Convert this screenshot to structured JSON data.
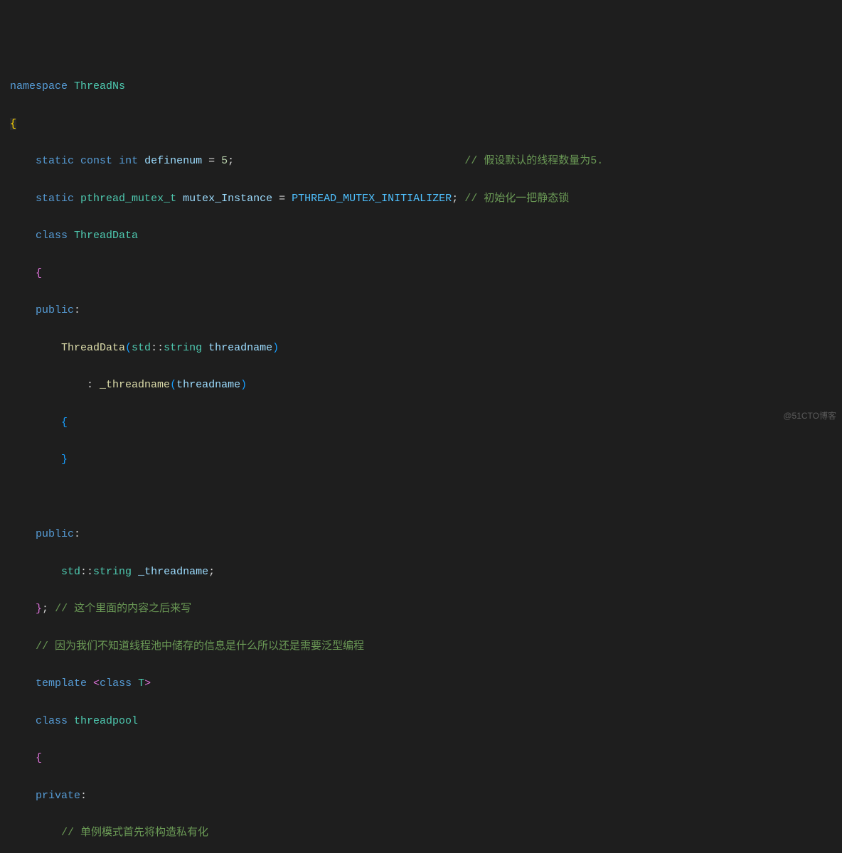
{
  "code": {
    "l1_kw": "namespace",
    "l1_name": "ThreadNs",
    "l2_brace": "{",
    "l4_static": "static",
    "l4_const": "const",
    "l4_int": "int",
    "l4_var": "definenum",
    "l4_eq": " = ",
    "l4_val": "5",
    "l4_semi": ";",
    "l4_cmt": "// 假设默认的线程数量为5.",
    "l5_static": "static",
    "l5_type": "pthread_mutex_t",
    "l5_var": "mutex_Instance",
    "l5_eq": " = ",
    "l5_val": "PTHREAD_MUTEX_INITIALIZER",
    "l5_semi": ";",
    "l5_cmt": "// 初始化一把静态锁",
    "l6_class": "class",
    "l6_name": "ThreadData",
    "l7_brace": "{",
    "l8_public": "public",
    "l8_colon": ":",
    "l9_ctor": "ThreadData",
    "l9_p1": "(",
    "l9_ns": "std",
    "l9_cc": "::",
    "l9_str": "string",
    "l9_arg": "threadname",
    "l9_p2": ")",
    "l10_colon": ": ",
    "l10_member": "_threadname",
    "l10_p1": "(",
    "l10_arg": "threadname",
    "l10_p2": ")",
    "l11_brace": "{",
    "l12_brace": "}",
    "l14_public": "public",
    "l14_colon": ":",
    "l15_ns": "std",
    "l15_cc": "::",
    "l15_str": "string",
    "l15_member": "_threadname",
    "l15_semi": ";",
    "l16_brace": "}",
    "l16_semi": ";",
    "l16_cmt": "// 这个里面的内容之后来写",
    "l17_cmt": "// 因为我们不知道线程池中储存的信息是什么所以还是需要泛型编程",
    "l18_tmpl": "template",
    "l18_lt": "<",
    "l18_class": "class",
    "l18_t": "T",
    "l18_gt": ">",
    "l19_class": "class",
    "l19_name": "threadpool",
    "l20_brace": "{",
    "l21_private": "private",
    "l21_colon": ":",
    "l22_cmt": "// 单例模式首先将构造私有化"
  },
  "watermark": "@51CTO博客"
}
